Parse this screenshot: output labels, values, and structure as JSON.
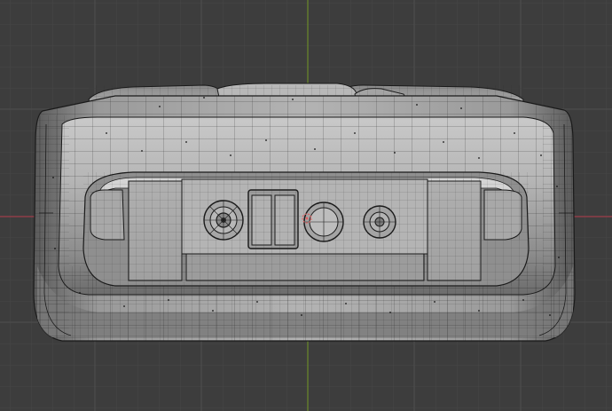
{
  "viewport": {
    "view": "front-orthographic",
    "shading": "solid-wireframe",
    "colors": {
      "background": "#3d3d3d",
      "grid_minor": "#474747",
      "grid_major": "#515151",
      "axis_x": "#9b3b47",
      "axis_z": "#6b8a2a",
      "mesh_fill": "#9a9a9a",
      "mesh_light": "#c8c8c8",
      "mesh_dark": "#6a6a6a",
      "wire": "#1a1a1a",
      "selected_vertex": "#e06060"
    },
    "icons": [
      "selected-vertex-marker-icon"
    ]
  }
}
